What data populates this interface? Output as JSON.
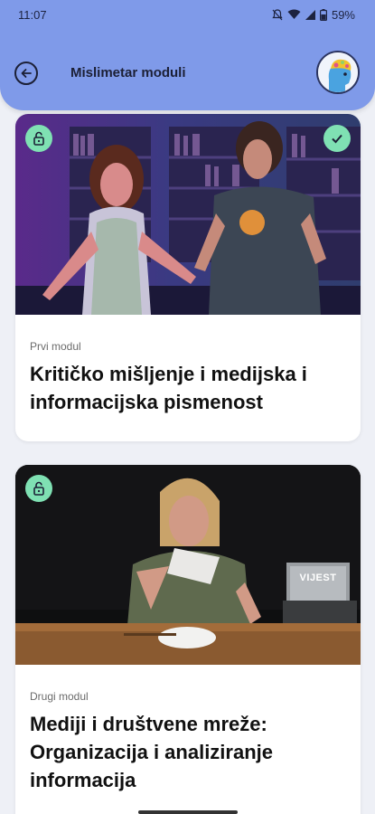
{
  "status_bar": {
    "time": "11:07",
    "battery": "59%"
  },
  "header": {
    "title": "Mislimetar moduli"
  },
  "modules": [
    {
      "label": "Prvi modul",
      "title_line1": "Kritičko mišljenje i medijska i",
      "title_line2": "informacijska pismenost",
      "unlocked": true,
      "completed": true
    },
    {
      "label": "Drugi modul",
      "title_line1": "Mediji i društvene mreže:",
      "title_line2": "Organizacija i analiziranje",
      "title_line3": "informacija",
      "unlocked": true,
      "completed": false
    }
  ],
  "illustrations": {
    "box_text": "VIJEST"
  },
  "colors": {
    "header": "#7f9ae9",
    "badge": "#7fe1b3",
    "background": "#eef0f6"
  }
}
